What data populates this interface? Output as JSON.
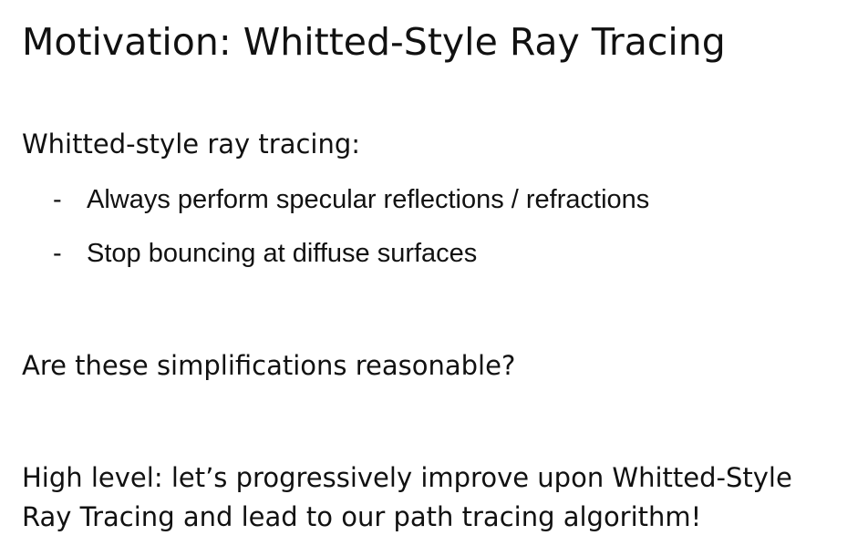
{
  "slide": {
    "title": "Motivation: Whitted-Style Ray Tracing",
    "intro": "Whitted-style ray tracing:",
    "bullets": [
      "Always perform specular reflections / refractions",
      "Stop bouncing at diffuse surfaces"
    ],
    "bullet_marker": "-",
    "question": "Are these simplifications reasonable?",
    "conclusion_lines": [
      "High level: let’s progressively improve upon Whitted-Style",
      "Ray Tracing and lead to our path tracing algorithm!"
    ]
  }
}
